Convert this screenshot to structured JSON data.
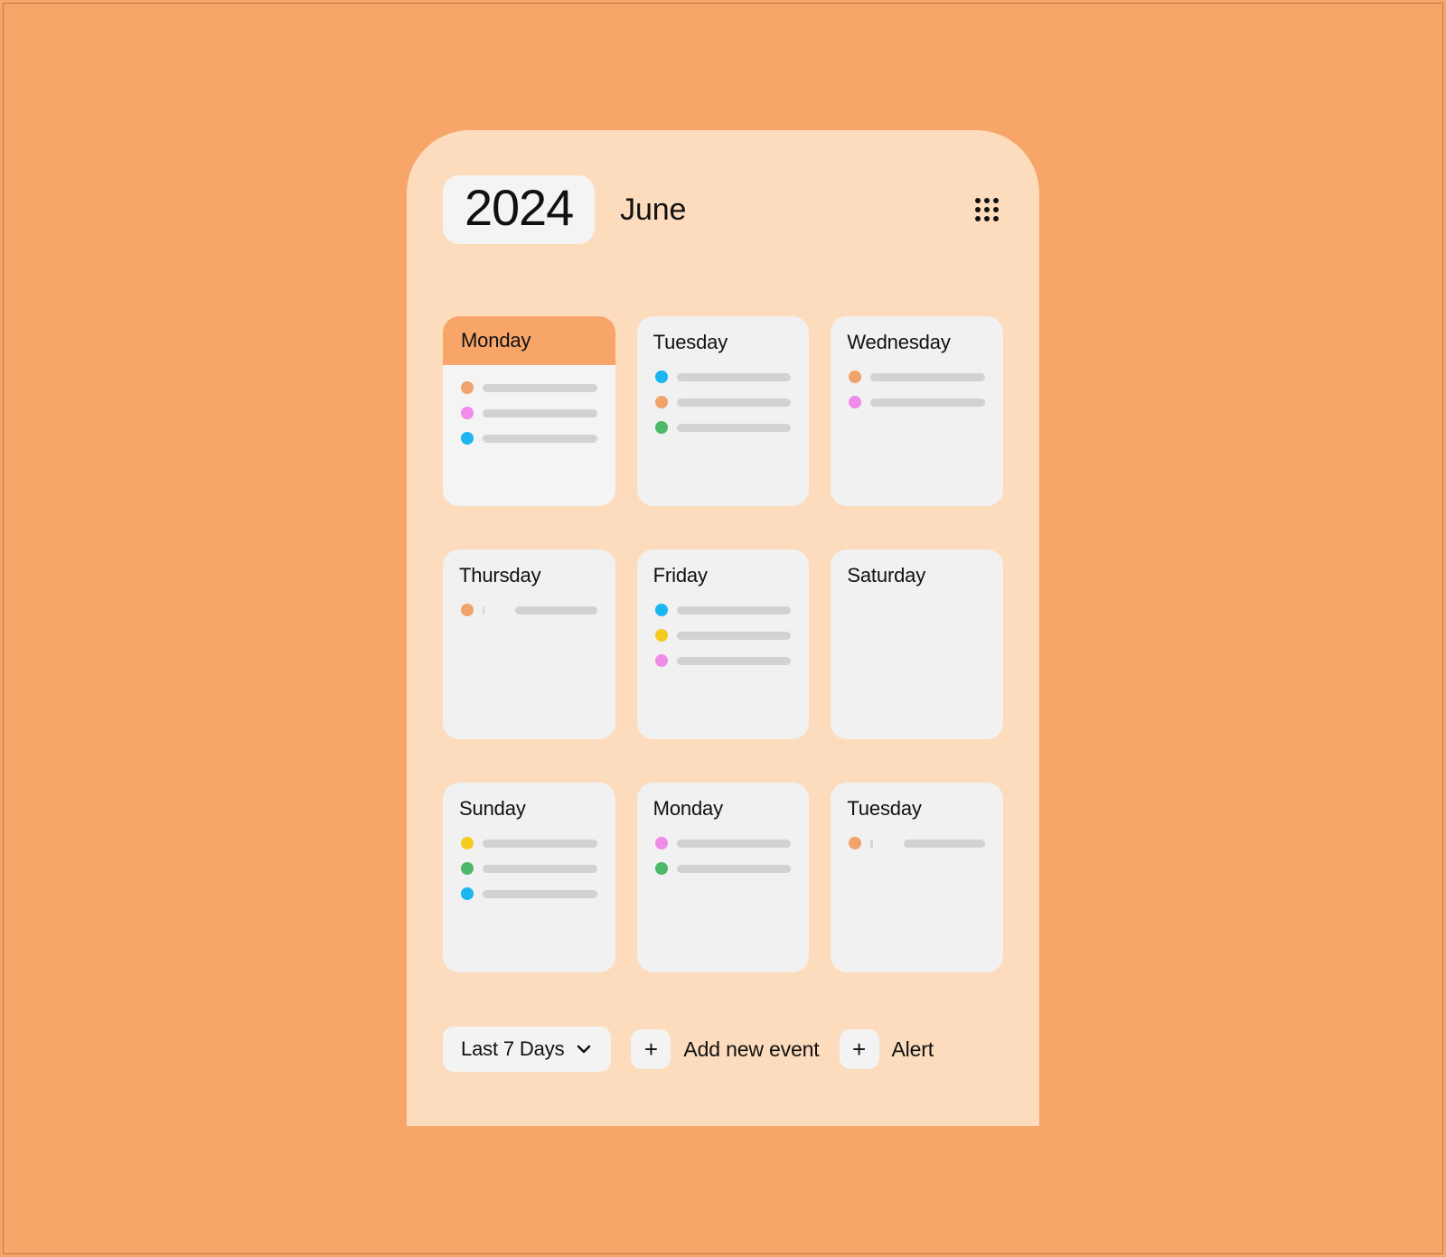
{
  "header": {
    "year": "2024",
    "month": "June"
  },
  "colors": {
    "orange": "#f0a36a",
    "pink": "#ef8be9",
    "blue": "#1bb6ef",
    "green": "#4cb86a",
    "yellow": "#f3cc1f"
  },
  "days": [
    {
      "name": "Monday",
      "selected": true,
      "events": [
        {
          "color": "orange"
        },
        {
          "color": "pink"
        },
        {
          "color": "blue"
        }
      ]
    },
    {
      "name": "Tuesday",
      "selected": false,
      "events": [
        {
          "color": "blue"
        },
        {
          "color": "orange"
        },
        {
          "color": "green"
        }
      ]
    },
    {
      "name": "Wednesday",
      "selected": false,
      "events": [
        {
          "color": "orange"
        },
        {
          "color": "pink"
        }
      ]
    },
    {
      "name": "Thursday",
      "selected": false,
      "events": [
        {
          "color": "orange",
          "wrap": true
        }
      ]
    },
    {
      "name": "Friday",
      "selected": false,
      "events": [
        {
          "color": "blue"
        },
        {
          "color": "yellow"
        },
        {
          "color": "pink"
        }
      ]
    },
    {
      "name": "Saturday",
      "selected": false,
      "events": []
    },
    {
      "name": "Sunday",
      "selected": false,
      "events": [
        {
          "color": "yellow"
        },
        {
          "color": "green"
        },
        {
          "color": "blue"
        }
      ]
    },
    {
      "name": "Monday",
      "selected": false,
      "events": [
        {
          "color": "pink"
        },
        {
          "color": "green"
        }
      ]
    },
    {
      "name": "Tuesday",
      "selected": false,
      "events": [
        {
          "color": "orange",
          "wrap": true
        }
      ]
    }
  ],
  "toolbar": {
    "range_label": "Last 7 Days",
    "add_event_label": "Add new event",
    "alert_label": "Alert"
  }
}
